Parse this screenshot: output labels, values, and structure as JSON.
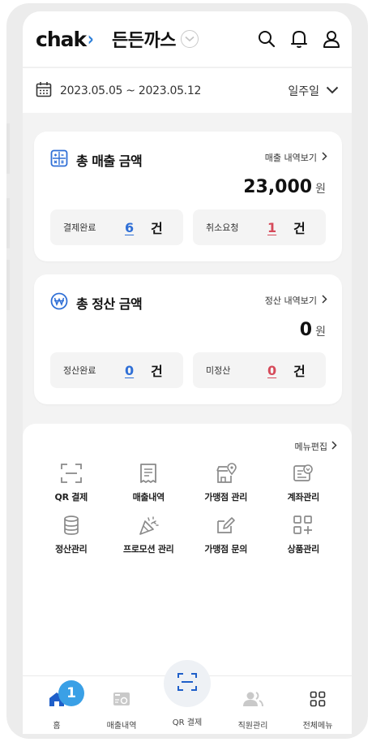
{
  "header": {
    "logo_text": "chak",
    "logo_chevron": "›",
    "store_name": "든든까스",
    "icons": [
      "search-icon",
      "bell-icon",
      "user-icon"
    ]
  },
  "date_bar": {
    "date_range": "2023.05.05 ~ 2023.05.12",
    "period": "일주일"
  },
  "sales_card": {
    "title": "총 매출 금액",
    "link": "매출 내역보기",
    "amount": "23,000",
    "unit": "원",
    "stats": [
      {
        "label": "결제완료",
        "count": "6",
        "unit": "건",
        "color": "#2f6fd6"
      },
      {
        "label": "취소요청",
        "count": "1",
        "unit": "건",
        "color": "#d64a5a"
      }
    ]
  },
  "settle_card": {
    "title": "총 정산 금액",
    "link": "정산 내역보기",
    "amount": "0",
    "unit": "원",
    "stats": [
      {
        "label": "정산완료",
        "count": "0",
        "unit": "건",
        "color": "#2f6fd6"
      },
      {
        "label": "미정산",
        "count": "0",
        "unit": "건",
        "color": "#d64a5a"
      }
    ]
  },
  "menu": {
    "edit_label": "메뉴편집",
    "items": [
      {
        "label": "QR 결제",
        "icon": "qr-scan-icon"
      },
      {
        "label": "매출내역",
        "icon": "receipt-icon"
      },
      {
        "label": "가맹점 관리",
        "icon": "store-location-icon"
      },
      {
        "label": "계좌관리",
        "icon": "account-icon"
      },
      {
        "label": "정산관리",
        "icon": "database-icon"
      },
      {
        "label": "프로모션 관리",
        "icon": "party-icon"
      },
      {
        "label": "가맹점 문의",
        "icon": "edit-icon"
      },
      {
        "label": "상품관리",
        "icon": "grid-add-icon"
      }
    ]
  },
  "tabbar": {
    "items": [
      {
        "label": "홈",
        "icon": "home-icon"
      },
      {
        "label": "매출내역",
        "icon": "sales-icon"
      },
      {
        "label": "QR 결제",
        "icon": "qr-scan-icon"
      },
      {
        "label": "직원관리",
        "icon": "staff-icon"
      },
      {
        "label": "전체메뉴",
        "icon": "all-menu-icon"
      }
    ],
    "badge": "1"
  },
  "colors": {
    "accent": "#2d7fd8",
    "primary_blue": "#2f6fd6",
    "alert_red": "#d64a5a",
    "badge": "#3aa0e6"
  }
}
